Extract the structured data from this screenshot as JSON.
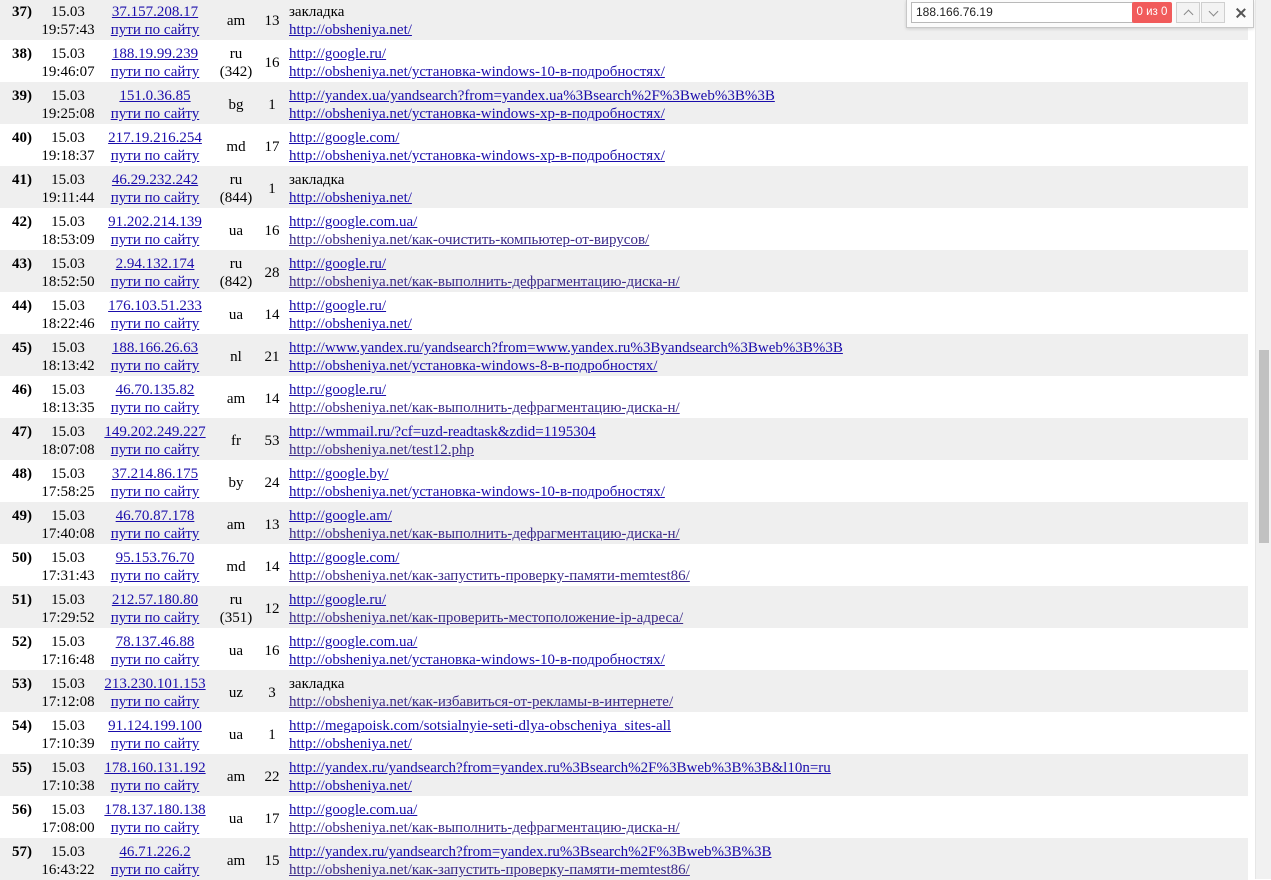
{
  "findbar": {
    "query": "188.166.76.19",
    "match_count": "0 из 0"
  },
  "rows": [
    {
      "num": "37)",
      "date": "15.03",
      "time": "19:57:43",
      "ip": "37.157.208.17",
      "paths": "пути по сайту",
      "country": "am",
      "country_count": "",
      "count": "13",
      "referrer": "закладка",
      "referrer_is_link": false,
      "page": "http://obsheniya.net/"
    },
    {
      "num": "38)",
      "date": "15.03",
      "time": "19:46:07",
      "ip": "188.19.99.239",
      "paths": "пути по сайту",
      "country": "ru",
      "country_count": "(342)",
      "count": "16",
      "referrer": "http://google.ru/",
      "referrer_is_link": true,
      "page": "http://obsheniya.net/установка-windows-10-в-подробностях/"
    },
    {
      "num": "39)",
      "date": "15.03",
      "time": "19:25:08",
      "ip": "151.0.36.85",
      "paths": "пути по сайту",
      "country": "bg",
      "country_count": "",
      "count": "1",
      "referrer": "http://yandex.ua/yandsearch?from=yandex.ua%3Bsearch%2F%3Bweb%3B%3B",
      "referrer_is_link": true,
      "page": "http://obsheniya.net/установка-windows-xp-в-подробностях/"
    },
    {
      "num": "40)",
      "date": "15.03",
      "time": "19:18:37",
      "ip": "217.19.216.254",
      "paths": "пути по сайту",
      "country": "md",
      "country_count": "",
      "count": "17",
      "referrer": "http://google.com/",
      "referrer_is_link": true,
      "page": "http://obsheniya.net/установка-windows-xp-в-подробностях/"
    },
    {
      "num": "41)",
      "date": "15.03",
      "time": "19:11:44",
      "ip": "46.29.232.242",
      "paths": "пути по сайту",
      "country": "ru",
      "country_count": "(844)",
      "count": "1",
      "referrer": "закладка",
      "referrer_is_link": false,
      "page": "http://obsheniya.net/"
    },
    {
      "num": "42)",
      "date": "15.03",
      "time": "18:53:09",
      "ip": "91.202.214.139",
      "paths": "пути по сайту",
      "country": "ua",
      "country_count": "",
      "count": "16",
      "referrer": "http://google.com.ua/",
      "referrer_is_link": true,
      "page": "http://obsheniya.net/как-очистить-компьютер-от-вирусов/"
    },
    {
      "num": "43)",
      "date": "15.03",
      "time": "18:52:50",
      "ip": "2.94.132.174",
      "paths": "пути по сайту",
      "country": "ru",
      "country_count": "(842)",
      "count": "28",
      "referrer": "http://google.ru/",
      "referrer_is_link": true,
      "page": "http://obsheniya.net/как-выполнить-дефрагментацию-диска-н/"
    },
    {
      "num": "44)",
      "date": "15.03",
      "time": "18:22:46",
      "ip": "176.103.51.233",
      "paths": "пути по сайту",
      "country": "ua",
      "country_count": "",
      "count": "14",
      "referrer": "http://google.ru/",
      "referrer_is_link": true,
      "page": "http://obsheniya.net/"
    },
    {
      "num": "45)",
      "date": "15.03",
      "time": "18:13:42",
      "ip": "188.166.26.63",
      "paths": "пути по сайту",
      "country": "nl",
      "country_count": "",
      "count": "21",
      "referrer": "http://www.yandex.ru/yandsearch?from=www.yandex.ru%3Byandsearch%3Bweb%3B%3B",
      "referrer_is_link": true,
      "page": "http://obsheniya.net/установка-windows-8-в-подробностях/"
    },
    {
      "num": "46)",
      "date": "15.03",
      "time": "18:13:35",
      "ip": "46.70.135.82",
      "paths": "пути по сайту",
      "country": "am",
      "country_count": "",
      "count": "14",
      "referrer": "http://google.ru/",
      "referrer_is_link": true,
      "page": "http://obsheniya.net/как-выполнить-дефрагментацию-диска-н/"
    },
    {
      "num": "47)",
      "date": "15.03",
      "time": "18:07:08",
      "ip": "149.202.249.227",
      "paths": "пути по сайту",
      "country": "fr",
      "country_count": "",
      "count": "53",
      "referrer": "http://wmmail.ru/?cf=uzd-readtask&zdid=1195304",
      "referrer_is_link": true,
      "page": "http://obsheniya.net/test12.php"
    },
    {
      "num": "48)",
      "date": "15.03",
      "time": "17:58:25",
      "ip": "37.214.86.175",
      "paths": "пути по сайту",
      "country": "by",
      "country_count": "",
      "count": "24",
      "referrer": "http://google.by/",
      "referrer_is_link": true,
      "page": "http://obsheniya.net/установка-windows-10-в-подробностях/"
    },
    {
      "num": "49)",
      "date": "15.03",
      "time": "17:40:08",
      "ip": "46.70.87.178",
      "paths": "пути по сайту",
      "country": "am",
      "country_count": "",
      "count": "13",
      "referrer": "http://google.am/",
      "referrer_is_link": true,
      "page": "http://obsheniya.net/как-выполнить-дефрагментацию-диска-н/"
    },
    {
      "num": "50)",
      "date": "15.03",
      "time": "17:31:43",
      "ip": "95.153.76.70",
      "paths": "пути по сайту",
      "country": "md",
      "country_count": "",
      "count": "14",
      "referrer": "http://google.com/",
      "referrer_is_link": true,
      "page": "http://obsheniya.net/как-запустить-проверку-памяти-memtest86/"
    },
    {
      "num": "51)",
      "date": "15.03",
      "time": "17:29:52",
      "ip": "212.57.180.80",
      "paths": "пути по сайту",
      "country": "ru",
      "country_count": "(351)",
      "count": "12",
      "referrer": "http://google.ru/",
      "referrer_is_link": true,
      "page": "http://obsheniya.net/как-проверить-местоположение-ip-адреса/"
    },
    {
      "num": "52)",
      "date": "15.03",
      "time": "17:16:48",
      "ip": "78.137.46.88",
      "paths": "пути по сайту",
      "country": "ua",
      "country_count": "",
      "count": "16",
      "referrer": "http://google.com.ua/",
      "referrer_is_link": true,
      "page": "http://obsheniya.net/установка-windows-10-в-подробностях/"
    },
    {
      "num": "53)",
      "date": "15.03",
      "time": "17:12:08",
      "ip": "213.230.101.153",
      "paths": "пути по сайту",
      "country": "uz",
      "country_count": "",
      "count": "3",
      "referrer": "закладка",
      "referrer_is_link": false,
      "page": "http://obsheniya.net/как-избавиться-от-рекламы-в-интернете/"
    },
    {
      "num": "54)",
      "date": "15.03",
      "time": "17:10:39",
      "ip": "91.124.199.100",
      "paths": "пути по сайту",
      "country": "ua",
      "country_count": "",
      "count": "1",
      "referrer": "http://megapoisk.com/sotsialnyie-seti-dlya-obscheniya_sites-all",
      "referrer_is_link": true,
      "page": "http://obsheniya.net/"
    },
    {
      "num": "55)",
      "date": "15.03",
      "time": "17:10:38",
      "ip": "178.160.131.192",
      "paths": "пути по сайту",
      "country": "am",
      "country_count": "",
      "count": "22",
      "referrer": "http://yandex.ru/yandsearch?from=yandex.ru%3Bsearch%2F%3Bweb%3B%3B&l10n=ru",
      "referrer_is_link": true,
      "page": "http://obsheniya.net/"
    },
    {
      "num": "56)",
      "date": "15.03",
      "time": "17:08:00",
      "ip": "178.137.180.138",
      "paths": "пути по сайту",
      "country": "ua",
      "country_count": "",
      "count": "17",
      "referrer": "http://google.com.ua/",
      "referrer_is_link": true,
      "page": "http://obsheniya.net/как-выполнить-дефрагментацию-диска-н/"
    },
    {
      "num": "57)",
      "date": "15.03",
      "time": "16:43:22",
      "ip": "46.71.226.2",
      "paths": "пути по сайту",
      "country": "am",
      "country_count": "",
      "count": "15",
      "referrer": "http://yandex.ru/yandsearch?from=yandex.ru%3Bsearch%2F%3Bweb%3B%3B",
      "referrer_is_link": true,
      "page": "http://obsheniya.net/как-запустить-проверку-памяти-memtest86/"
    }
  ],
  "colors": {
    "link": "#1a0dab",
    "row_shade": "#efefef",
    "find_count_bg": "#f15b5b"
  }
}
